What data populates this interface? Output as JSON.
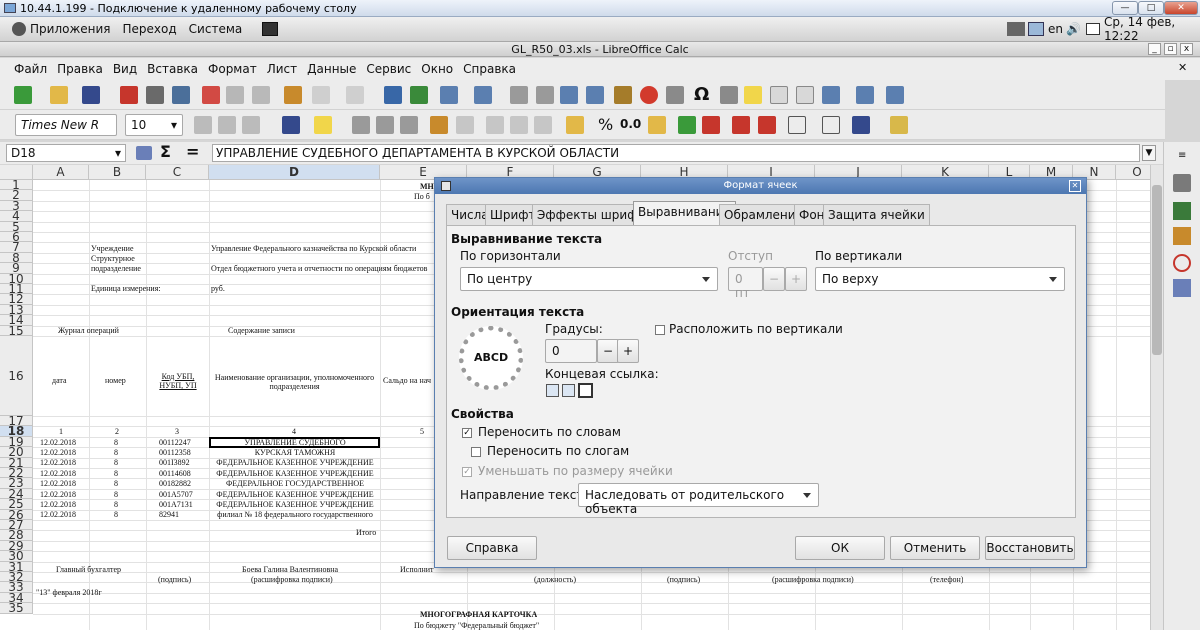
{
  "rdp": {
    "title": "10.44.1.199 - Подключение к удаленному рабочему столу"
  },
  "gnome": {
    "apps": "Приложения",
    "places": "Переход",
    "system": "Система",
    "lang": "en",
    "clock": "Ср, 14 фев, 12:22"
  },
  "window": {
    "title": "GL_R50_03.xls - LibreOffice Calc"
  },
  "menu": [
    "Файл",
    "Правка",
    "Вид",
    "Вставка",
    "Формат",
    "Лист",
    "Данные",
    "Сервис",
    "Окно",
    "Справка"
  ],
  "format": {
    "font": "Times New R",
    "size": "10",
    "zero": "0.0"
  },
  "formula": {
    "cell": "D18",
    "sum": "Σ",
    "eq": "=",
    "value": "УПРАВЛЕНИЕ СУДЕБНОГО ДЕПАРТАМЕНТА В КУРСКОЙ ОБЛАСТИ"
  },
  "columns": [
    "A",
    "B",
    "C",
    "D",
    "E",
    "F",
    "G",
    "H",
    "I",
    "J",
    "K",
    "L",
    "M",
    "N",
    "O"
  ],
  "rows": [
    "1",
    "2",
    "3",
    "4",
    "5",
    "6",
    "7",
    "8",
    "9",
    "10",
    "11",
    "12",
    "13",
    "14",
    "15",
    "16",
    "17",
    "18",
    "19",
    "20",
    "21",
    "22",
    "23",
    "24",
    "25",
    "26",
    "27",
    "28",
    "29",
    "30",
    "31",
    "32",
    "33",
    "34",
    "35"
  ],
  "sheet": {
    "r1": "МН",
    "r2": "По б",
    "inst_lbl": "Учреждение",
    "inst_val": "Управление Федерального казначейства по Курской области",
    "struct_lbl": "Структурное",
    "sub_lbl": "подразделение",
    "sub_val": "Отдел бюджетного учета и отчетности по операциям бюджетов",
    "unit_lbl": "Единица измерения:",
    "unit_val": "руб.",
    "journal": "Журнал операций",
    "content": "Содержание записи",
    "h_date": "дата",
    "h_num": "номер",
    "h_code": "Код УБП, НУБП, УП",
    "h_name": "Наименование организации, уполномоченного подразделения",
    "h_saldo": "Сальдо на нач",
    "n1": "1",
    "n2": "2",
    "n3": "3",
    "n4": "4",
    "n5": "5",
    "data": [
      {
        "date": "12.02.2018",
        "num": "8",
        "code": "00112247",
        "name": "УПРАВЛЕНИЕ СУДЕБНОГО"
      },
      {
        "date": "12.02.2018",
        "num": "8",
        "code": "00112358",
        "name": "КУРСКАЯ ТАМОЖНЯ"
      },
      {
        "date": "12.02.2018",
        "num": "8",
        "code": "001I3892",
        "name": "ФЕДЕРАЛЬНОЕ КАЗЕННОЕ УЧРЕЖДЕНИЕ"
      },
      {
        "date": "12.02.2018",
        "num": "8",
        "code": "00114608",
        "name": "ФЕДЕРАЛЬНОЕ КАЗЕННОЕ УЧРЕЖДЕНИЕ"
      },
      {
        "date": "12.02.2018",
        "num": "8",
        "code": "00182882",
        "name": "ФЕДЕРАЛЬНОЕ ГОСУДАРСТВЕННОЕ"
      },
      {
        "date": "12.02.2018",
        "num": "8",
        "code": "001A5707",
        "name": "ФЕДЕРАЛЬНОЕ КАЗЕННОЕ УЧРЕЖДЕНИЕ"
      },
      {
        "date": "12.02.2018",
        "num": "8",
        "code": "001A7131",
        "name": "ФЕДЕРАЛЬНОЕ КАЗЕННОЕ УЧРЕЖДЕНИЕ"
      },
      {
        "date": "12.02.2018",
        "num": "8",
        "code": "82941",
        "name": "филиал № 18 федерального государственного"
      }
    ],
    "total": "Итого",
    "chief": "Главный бухгалтер",
    "chief_name": "Боева Галина Валентиновна",
    "executor": "Исполнит",
    "sign": "(подпись)",
    "decode": "(расшифровка подписи)",
    "position": "(должность)",
    "sign2": "(подпись)",
    "decode2": "(расшифровка подписи)",
    "phone": "(телефон)",
    "date_line": "\"13\" февраля 2018г",
    "card": "МНОГОГРАФНАЯ КАРТОЧКА",
    "card2": "По бюджету \"Федеральный бюджет\""
  },
  "dialog": {
    "title": "Формат ячеек",
    "tabs": [
      "Числа",
      "Шрифт",
      "Эффекты шрифта",
      "Выравнивание",
      "Обрамление",
      "Фон",
      "Защита ячейки"
    ],
    "sec_align": "Выравнивание текста",
    "horiz_lbl": "По горизонтали",
    "horiz_val": "По центру",
    "indent_lbl": "Отступ",
    "indent_val": "0 пт",
    "vert_lbl": "По вертикали",
    "vert_val": "По верху",
    "sec_orient": "Ориентация текста",
    "dial_text": "ABCD",
    "degrees_lbl": "Градусы:",
    "degrees_val": "0",
    "stack_lbl": "Расположить по вертикали",
    "ref_lbl": "Концевая ссылка:",
    "sec_props": "Свойства",
    "wrap_lbl": "Переносить по словам",
    "hyph_lbl": "Переносить по слогам",
    "shrink_lbl": "Уменьшать по размеру ячейки",
    "dir_lbl": "Направление текста:",
    "dir_val": "Наследовать от родительского объекта",
    "help": "Справка",
    "ok": "ОК",
    "cancel": "Отменить",
    "reset": "Восстановить"
  }
}
